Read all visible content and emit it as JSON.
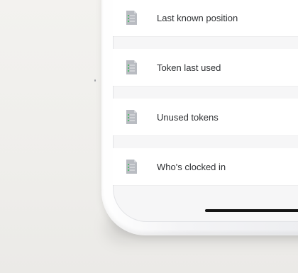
{
  "screen": {
    "list": {
      "items": [
        {
          "label": "Last known position",
          "icon": "document-list-icon"
        },
        {
          "label": "Token last used",
          "icon": "document-list-icon"
        },
        {
          "label": "Unused tokens",
          "icon": "document-list-icon"
        },
        {
          "label": "Who's clocked in",
          "icon": "document-list-icon"
        }
      ]
    }
  },
  "colors": {
    "background": "#f1f0ed",
    "screen": "#f6f6f7",
    "row": "#ffffff",
    "icon": "#b9bcc2",
    "icon_lines": "#4fbf6a",
    "text": "#2e3033"
  }
}
